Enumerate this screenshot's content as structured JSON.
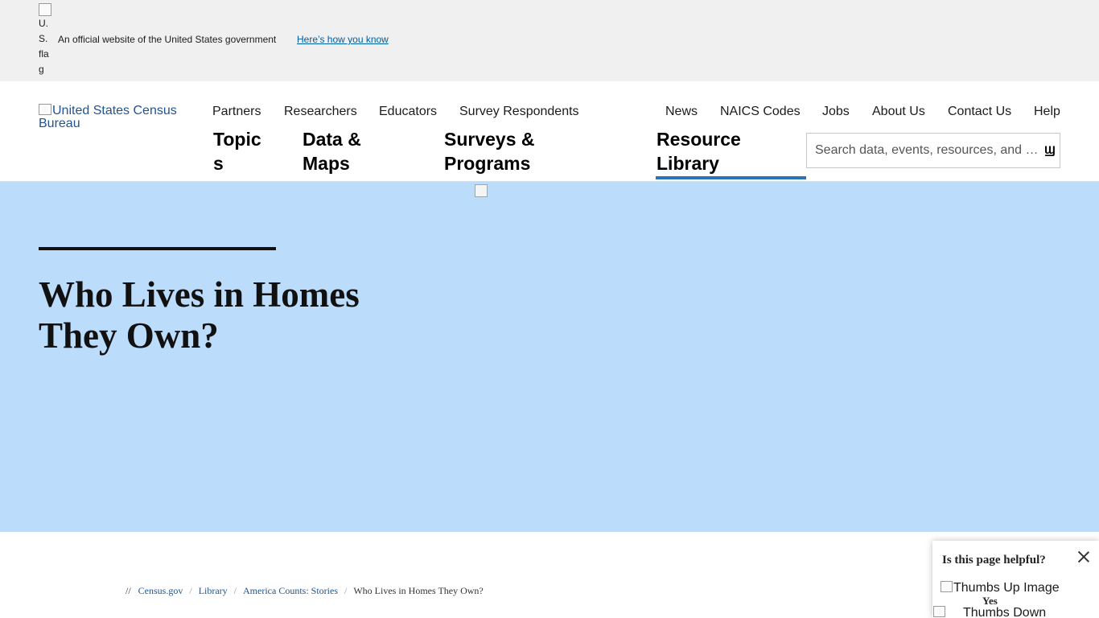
{
  "gov_banner": {
    "flag_alt": "U.S. flag",
    "flag_lines": [
      "U.",
      "S.",
      "fla",
      "g"
    ],
    "text": "An official website of the United States government",
    "link": "Here’s how you know"
  },
  "header": {
    "logo_alt": "United States Census Bureau",
    "audience_nav": [
      "Partners",
      "Researchers",
      "Educators",
      "Survey Respondents"
    ],
    "utility_nav": [
      "News",
      "NAICS Codes",
      "Jobs",
      "About Us",
      "Contact Us",
      "Help"
    ],
    "main_nav": [
      {
        "line1": "Topic",
        "line2": "s"
      },
      {
        "line1": "Data &",
        "line2": "Maps"
      },
      {
        "line1": "Surveys &",
        "line2": "Programs"
      },
      {
        "line1": "Resource",
        "line2": "Library"
      }
    ],
    "active_main_nav": "Resource Library",
    "search_placeholder": "Search data, events, resources, and …",
    "search_icon": "search-icon"
  },
  "hero": {
    "title": "Who Lives in Homes They Own?",
    "background_color": "#bcdcfb"
  },
  "breadcrumb": {
    "lead": "//",
    "items": [
      "Census.gov",
      "Library",
      "America Counts: Stories",
      "Who Lives in Homes They Own?"
    ]
  },
  "feedback": {
    "question": "Is this page helpful?",
    "thumbs_up_alt": "Thumbs Up Image",
    "yes_label": "Yes",
    "thumbs_down_alt": "Thumbs Down"
  },
  "colors": {
    "link": "#005ea2",
    "active_underline": "#2a73b8",
    "banner_bg": "#f0f0f0"
  }
}
